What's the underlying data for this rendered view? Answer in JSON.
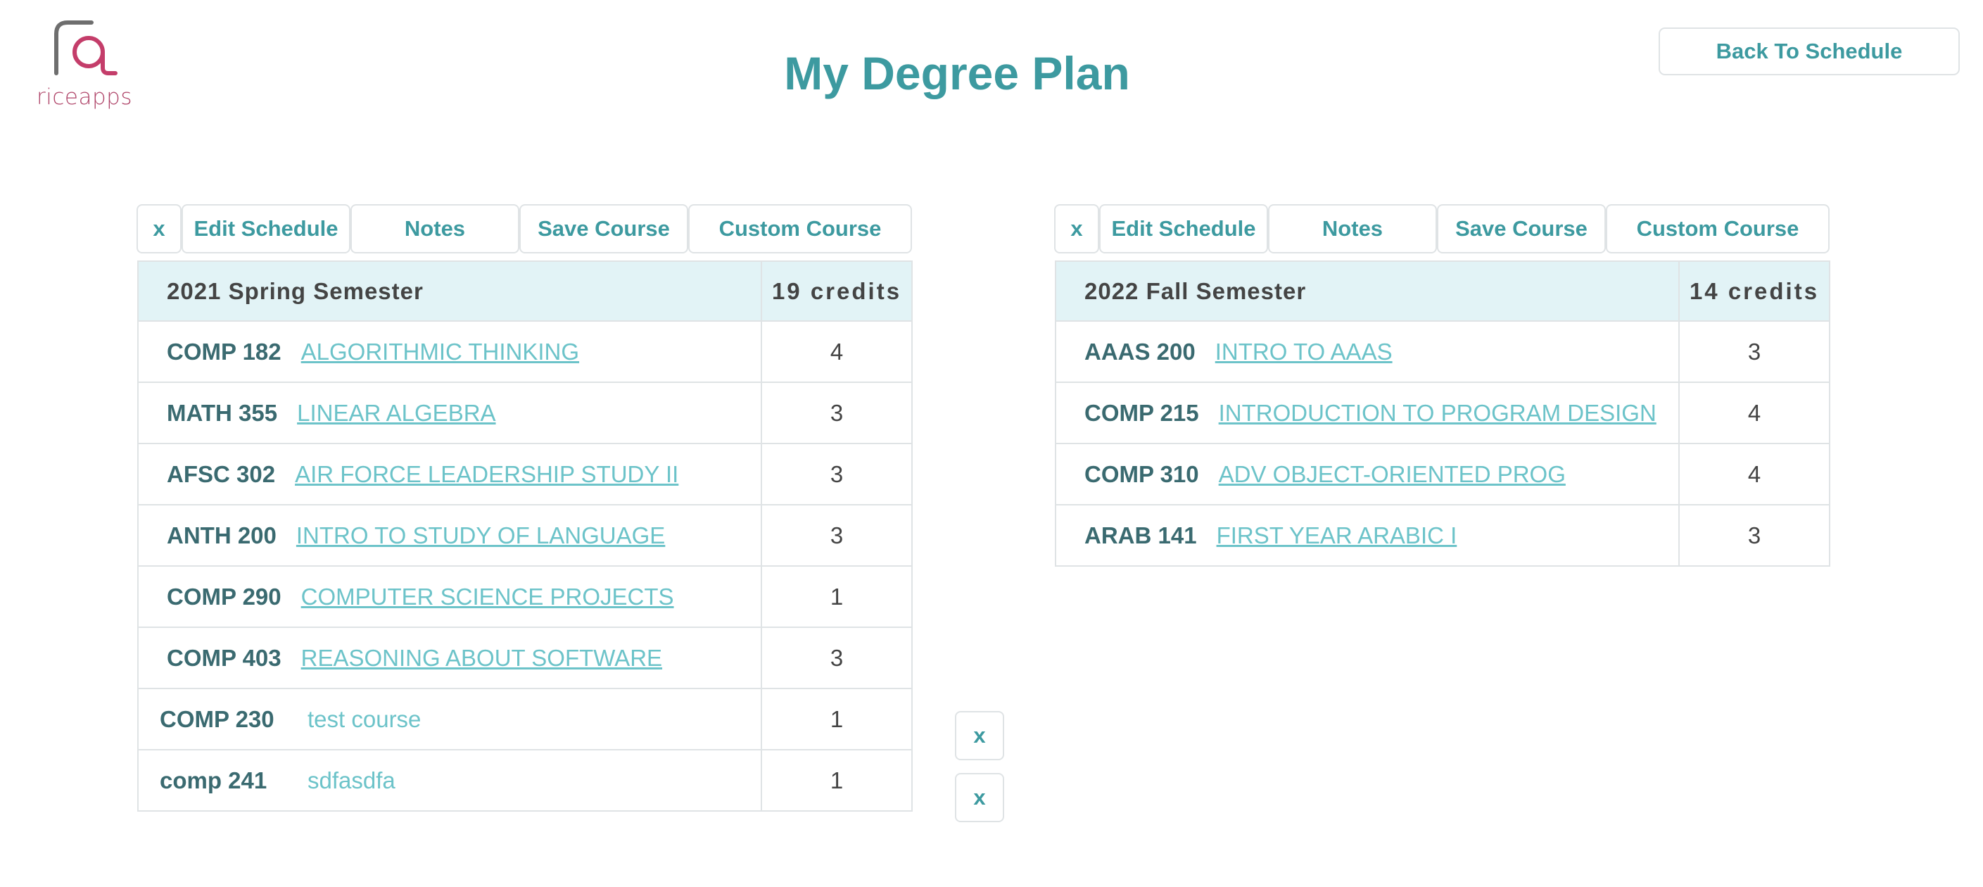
{
  "logo": {
    "text": "riceapps",
    "icon": "riceapps-logo-icon"
  },
  "header": {
    "title": "My Degree Plan",
    "back_label": "Back To Schedule"
  },
  "colors": {
    "accent": "#3d9aa0",
    "link": "#6cc3c9",
    "header_bg": "#e2f3f6",
    "brand": "#b0466a"
  },
  "semesters": [
    {
      "toolbar": {
        "remove": "x",
        "edit": "Edit Schedule",
        "notes": "Notes",
        "save": "Save Course",
        "custom": "Custom Course"
      },
      "name": "2021 Spring Semester",
      "credits": "19 credits",
      "courses": [
        {
          "code": "COMP 182",
          "name": "ALGORITHMIC THINKING",
          "credits": "4"
        },
        {
          "code": "MATH 355",
          "name": "LINEAR ALGEBRA",
          "credits": "3"
        },
        {
          "code": "AFSC 302",
          "name": "AIR FORCE LEADERSHIP STUDY II",
          "credits": "3"
        },
        {
          "code": "ANTH 200",
          "name": "INTRO TO STUDY OF LANGUAGE",
          "credits": "3"
        },
        {
          "code": "COMP 290",
          "name": "COMPUTER SCIENCE PROJECTS",
          "credits": "1"
        },
        {
          "code": "COMP 403",
          "name": "REASONING ABOUT SOFTWARE",
          "credits": "3"
        }
      ],
      "custom_courses": [
        {
          "code": "COMP 230",
          "name": "test course",
          "credits": "1",
          "delete": "x"
        },
        {
          "code": "comp 241",
          "name": "sdfasdfa",
          "credits": "1",
          "delete": "x"
        }
      ]
    },
    {
      "toolbar": {
        "remove": "x",
        "edit": "Edit Schedule",
        "notes": "Notes",
        "save": "Save Course",
        "custom": "Custom Course"
      },
      "name": "2022 Fall Semester",
      "credits": "14 credits",
      "courses": [
        {
          "code": "AAAS 200",
          "name": "INTRO TO AAAS",
          "credits": "3"
        },
        {
          "code": "COMP 215",
          "name": "INTRODUCTION TO PROGRAM DESIGN",
          "credits": "4"
        },
        {
          "code": "COMP 310",
          "name": "ADV OBJECT-ORIENTED PROG",
          "credits": "4"
        },
        {
          "code": "ARAB 141",
          "name": "FIRST YEAR ARABIC I",
          "credits": "3"
        }
      ],
      "custom_courses": []
    }
  ]
}
